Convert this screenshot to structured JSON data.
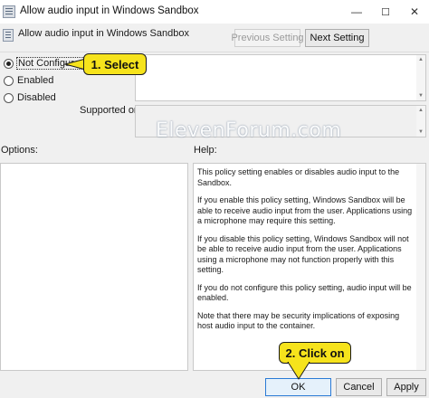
{
  "window": {
    "title": "Allow audio input in Windows Sandbox",
    "minimize_glyph": "—",
    "maximize_glyph": "☐",
    "close_glyph": "✕"
  },
  "header": {
    "policy_name": "Allow audio input in Windows Sandbox",
    "previous_label": "Previous Setting",
    "next_label": "Next Setting"
  },
  "state": {
    "options": [
      {
        "label": "Not Configured",
        "selected": true
      },
      {
        "label": "Enabled",
        "selected": false
      },
      {
        "label": "Disabled",
        "selected": false
      }
    ]
  },
  "labels": {
    "supported_on": "Supported on:",
    "options": "Options:",
    "help": "Help:"
  },
  "help_text": [
    "This policy setting enables or disables audio input to the Sandbox.",
    "If you enable this policy setting, Windows Sandbox will be able to receive audio input from the user. Applications using a microphone may require this setting.",
    "If you disable this policy setting, Windows Sandbox will not be able to receive audio input from the user. Applications using a microphone may not function properly with this setting.",
    "If you do not configure this policy setting, audio input will be enabled.",
    "Note that there may be security implications of exposing host audio input to the container."
  ],
  "footer": {
    "ok_label": "OK",
    "cancel_label": "Cancel",
    "apply_label": "Apply"
  },
  "annotations": {
    "step1": "1. Select",
    "step2": "2. Click on",
    "watermark": "ElevenForum.com",
    "callout_color": "#f6e31c"
  },
  "icons": {
    "title": "policy-icon",
    "header": "policy-icon"
  }
}
